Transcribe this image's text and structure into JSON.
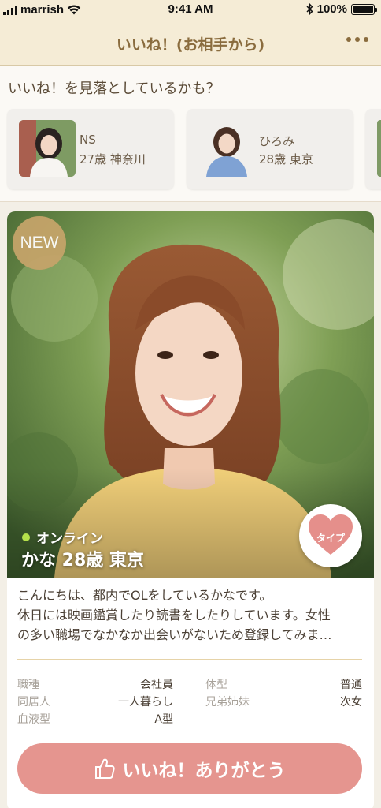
{
  "status_bar": {
    "carrier": "marrish",
    "time": "9:41 AM",
    "battery": "100%"
  },
  "nav": {
    "title": "いいね！(お相手から)"
  },
  "missed": {
    "title": "いいね！を見落としているかも？",
    "users": [
      {
        "name": "NS",
        "meta": "27歳 神奈川"
      },
      {
        "name": "ひろみ",
        "meta": "28歳 東京"
      }
    ]
  },
  "profile": {
    "badge": "NEW",
    "online": "オンライン",
    "name_line": "かな 28歳 東京",
    "type_label": "タイプ",
    "intro": [
      "こんにちは、都内でOLをしているかなです。",
      "休日には映画鑑賞したり読書をしたりしています。女性",
      "の多い職場でなかなか出会いがないため登録してみま…"
    ],
    "specs": [
      {
        "label": "職種",
        "value": "会社員"
      },
      {
        "label": "体型",
        "value": "普通"
      },
      {
        "label": "同居人",
        "value": "一人暮らし"
      },
      {
        "label": "兄弟姉妹",
        "value": "次女"
      },
      {
        "label": "血液型",
        "value": "A型"
      }
    ],
    "like_label": "いいね！ありがとう"
  },
  "colors": {
    "header_bg": "#f5ecd6",
    "header_text": "#8a6c3e",
    "badge": "#c5a46a",
    "like_button": "#e5958f",
    "online_dot": "#b5e04b"
  }
}
